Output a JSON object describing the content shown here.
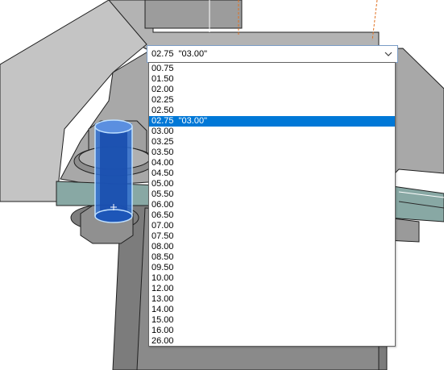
{
  "size_selector": {
    "value": "02.75  \"03.00\"",
    "options": [
      "00.75",
      "01.50",
      "02.00",
      "02.25",
      "02.50",
      "02.75  \"03.00\"",
      "03.00",
      "03.25",
      "03.50",
      "04.00",
      "04.50",
      "05.00",
      "05.50",
      "06.00",
      "06.50",
      "07.00",
      "07.50",
      "08.00",
      "08.50",
      "09.50",
      "10.00",
      "12.00",
      "13.00",
      "14.00",
      "15.00",
      "16.00",
      "26.00"
    ],
    "selected_index": 5
  },
  "colors": {
    "selection": "#0078d7",
    "highlight_blue": "#2f6fd0",
    "model_gray": "#a6a6a6",
    "plate_teal": "#88a8a4"
  },
  "icons": {
    "dropdown_arrow": "chevron-down-icon"
  }
}
